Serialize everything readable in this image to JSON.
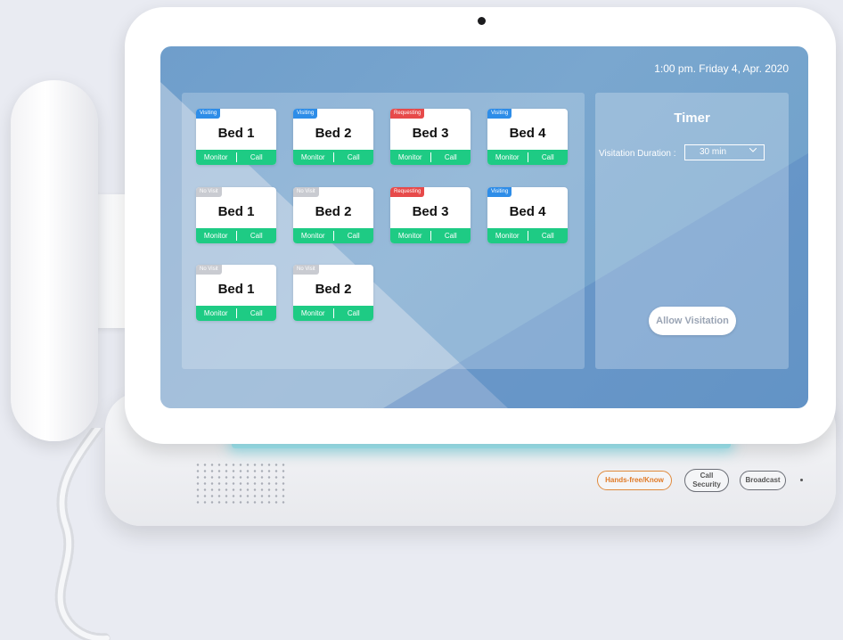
{
  "header": {
    "datetime": "1:00 pm. Friday 4, Apr. 2020"
  },
  "beds": [
    {
      "name": "Bed 1",
      "status": "Visiting",
      "status_type": "visiting",
      "monitor": "Monitor",
      "call": "Call"
    },
    {
      "name": "Bed 2",
      "status": "Visiting",
      "status_type": "visiting",
      "monitor": "Monitor",
      "call": "Call"
    },
    {
      "name": "Bed 3",
      "status": "Requesting",
      "status_type": "requesting",
      "monitor": "Monitor",
      "call": "Call"
    },
    {
      "name": "Bed 4",
      "status": "Visiting",
      "status_type": "visiting",
      "monitor": "Monitor",
      "call": "Call"
    },
    {
      "name": "Bed 1",
      "status": "No Visit",
      "status_type": "novisit",
      "monitor": "Monitor",
      "call": "Call"
    },
    {
      "name": "Bed 2",
      "status": "No Visit",
      "status_type": "novisit",
      "monitor": "Monitor",
      "call": "Call"
    },
    {
      "name": "Bed 3",
      "status": "Requesting",
      "status_type": "requesting",
      "monitor": "Monitor",
      "call": "Call"
    },
    {
      "name": "Bed 4",
      "status": "Visiting",
      "status_type": "visiting",
      "monitor": "Monitor",
      "call": "Call"
    },
    {
      "name": "Bed 1",
      "status": "No Visit",
      "status_type": "novisit",
      "monitor": "Monitor",
      "call": "Call"
    },
    {
      "name": "Bed 2",
      "status": "No Visit",
      "status_type": "novisit",
      "monitor": "Monitor",
      "call": "Call"
    }
  ],
  "timer": {
    "title": "Timer",
    "duration_label": "Visitation Duration :",
    "duration_value": "30 min",
    "allow_button": "Allow Visitation"
  },
  "hardware_buttons": {
    "hands_free": "Hands-free/Know",
    "call_security_line1": "Call",
    "call_security_line2": "Security",
    "broadcast": "Broadcast"
  },
  "colors": {
    "visiting": "#2e8de8",
    "requesting": "#e74a4a",
    "no_visit": "#c9cbd1",
    "action_bar": "#1ecb84",
    "hands_free_accent": "#e08a3c"
  }
}
